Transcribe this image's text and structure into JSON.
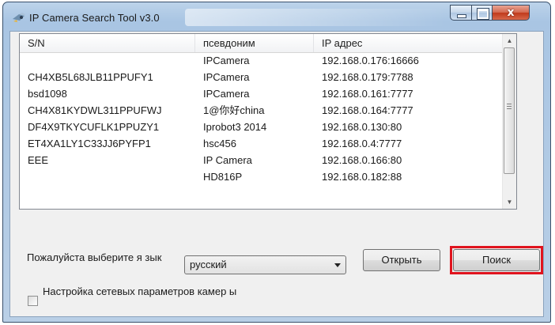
{
  "window": {
    "title": "IP Camera Search Tool  v3.0",
    "close_glyph": "x"
  },
  "table": {
    "columns": [
      "S/N",
      "псевдоним",
      "IP адрес"
    ],
    "rows": [
      [
        "",
        "IPCamera",
        "192.168.0.176:16666"
      ],
      [
        "CH4XB5L68JLB11PPUFY1",
        "IPCamera",
        "192.168.0.179:7788"
      ],
      [
        "bsd1098",
        "IPCamera",
        "192.168.0.161:7777"
      ],
      [
        "CH4X81KYDWL311PPUFWJ",
        "1@你好china",
        "192.168.0.164:7777"
      ],
      [
        "DF4X9TKYCUFLK1PPUZY1",
        "Iprobot3 2014",
        "192.168.0.130:80"
      ],
      [
        "ET4XA1LY1C33JJ6PYFP1",
        "hsc456",
        "192.168.0.4:7777"
      ],
      [
        "EEE",
        "IP Camera",
        "192.168.0.166:80"
      ],
      [
        "",
        "HD816P",
        "192.168.0.182:88"
      ]
    ]
  },
  "language": {
    "label": "Пожалуйста выберите я зык",
    "selected": "русский"
  },
  "buttons": {
    "open": "Открыть",
    "search": "Поиск"
  },
  "network_settings": {
    "label": "Настройка сетевых параметров камер ы",
    "checked": false
  },
  "icons": {
    "app": "camera-app-icon",
    "minimize": "minimize-icon",
    "maximize": "maximize-icon",
    "close": "close-icon",
    "combo": "chevron-down-icon",
    "scroll_up": "scroll-up-icon",
    "scroll_down": "scroll-down-icon"
  },
  "colors": {
    "highlight_outline": "#e0141e",
    "close_button": "#c0391b"
  }
}
